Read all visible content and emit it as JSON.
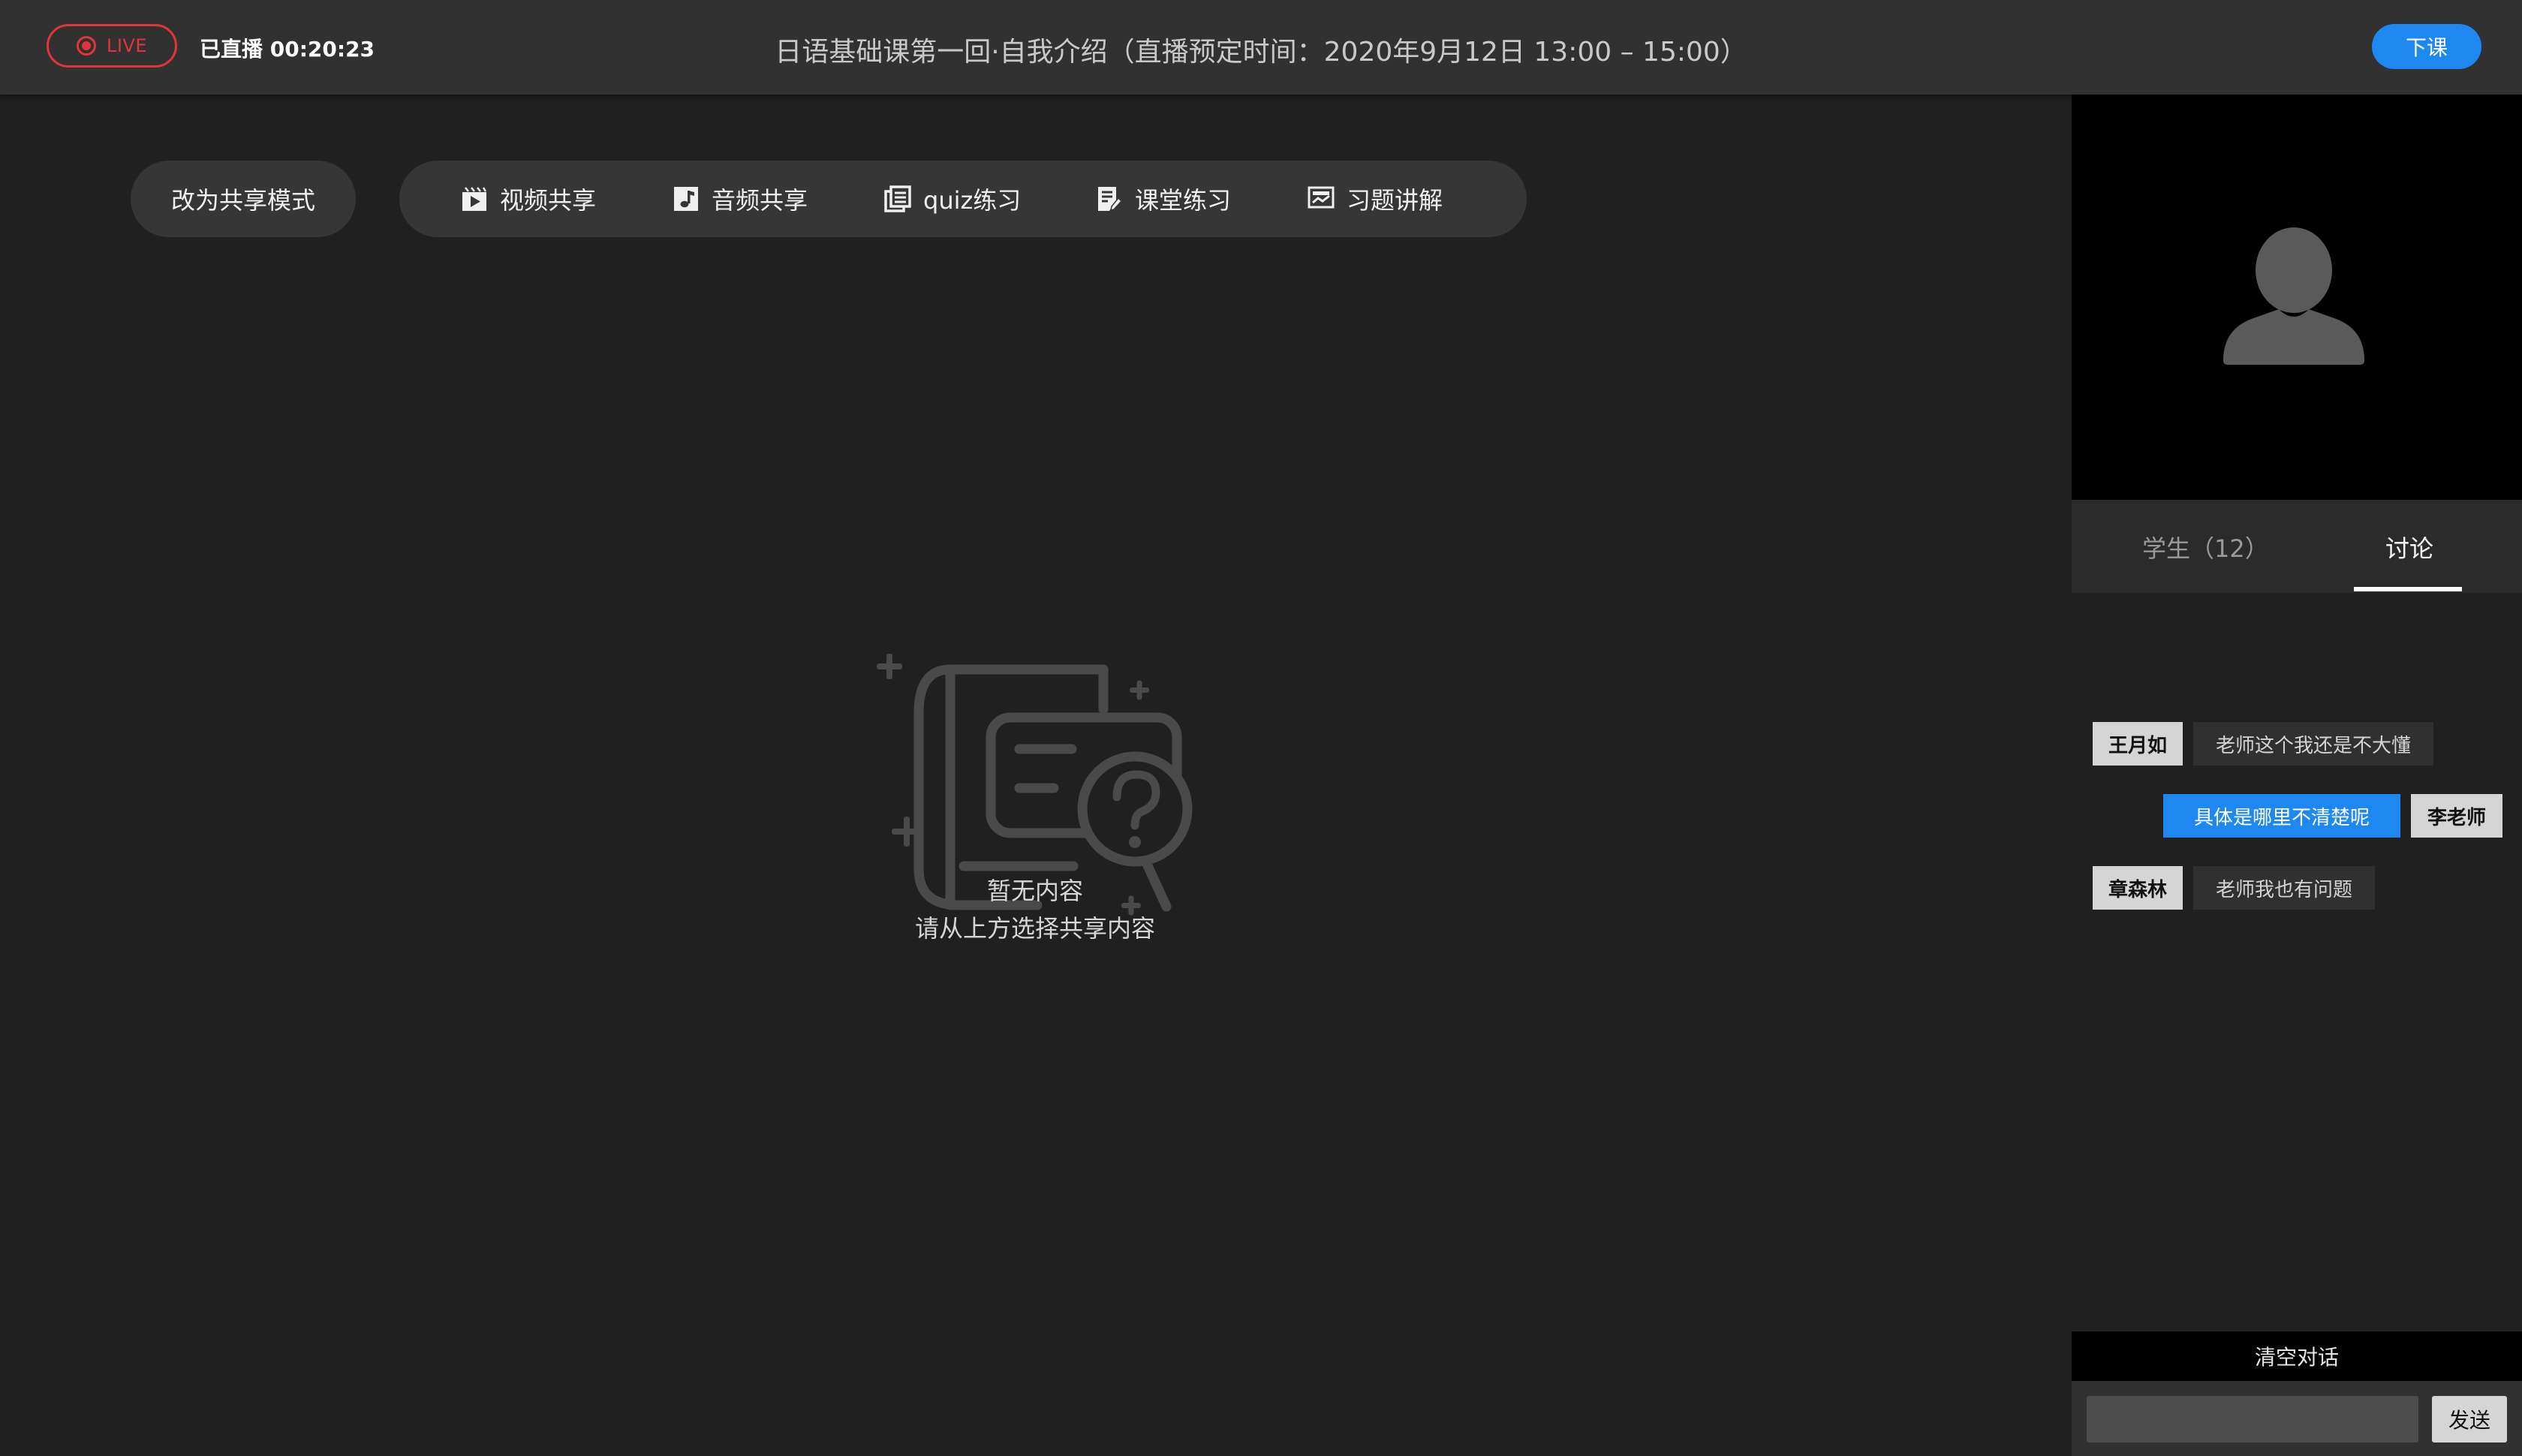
{
  "topbar": {
    "live_label": "LIVE",
    "elapsed": "已直播 00:20:23",
    "course_title": "日语基础课第一回·自我介绍（直播预定时间：2020年9月12日 13:00 – 15:00）",
    "end_button": "下课"
  },
  "toolbar": {
    "mode_button": "改为共享模式",
    "items": [
      {
        "label": "视频共享",
        "icon": "video-share-icon"
      },
      {
        "label": "音频共享",
        "icon": "music-note-icon"
      },
      {
        "label": "quiz练习",
        "icon": "quiz-icon"
      },
      {
        "label": "课堂练习",
        "icon": "exercise-edit-icon"
      },
      {
        "label": "习题讲解",
        "icon": "slides-icon"
      }
    ]
  },
  "empty_state": {
    "line1": "暂无内容",
    "line2": "请从上方选择共享内容"
  },
  "sidebar": {
    "tabs": [
      {
        "label": "学生（12）",
        "active": false
      },
      {
        "label": "讨论",
        "active": true
      }
    ],
    "messages": [
      {
        "name": "王月如",
        "text": "老师这个我还是不大懂",
        "side": "left"
      },
      {
        "name": "李老师",
        "text": "具体是哪里不清楚呢",
        "side": "right"
      },
      {
        "name": "章森林",
        "text": "老师我也有问题",
        "side": "left"
      }
    ],
    "clear_label": "清空对话",
    "input_placeholder": "",
    "send_label": "发送"
  },
  "colors": {
    "accent": "#1e88f0",
    "live_red": "#e0353f",
    "background": "#202020",
    "topbar": "#313131"
  }
}
